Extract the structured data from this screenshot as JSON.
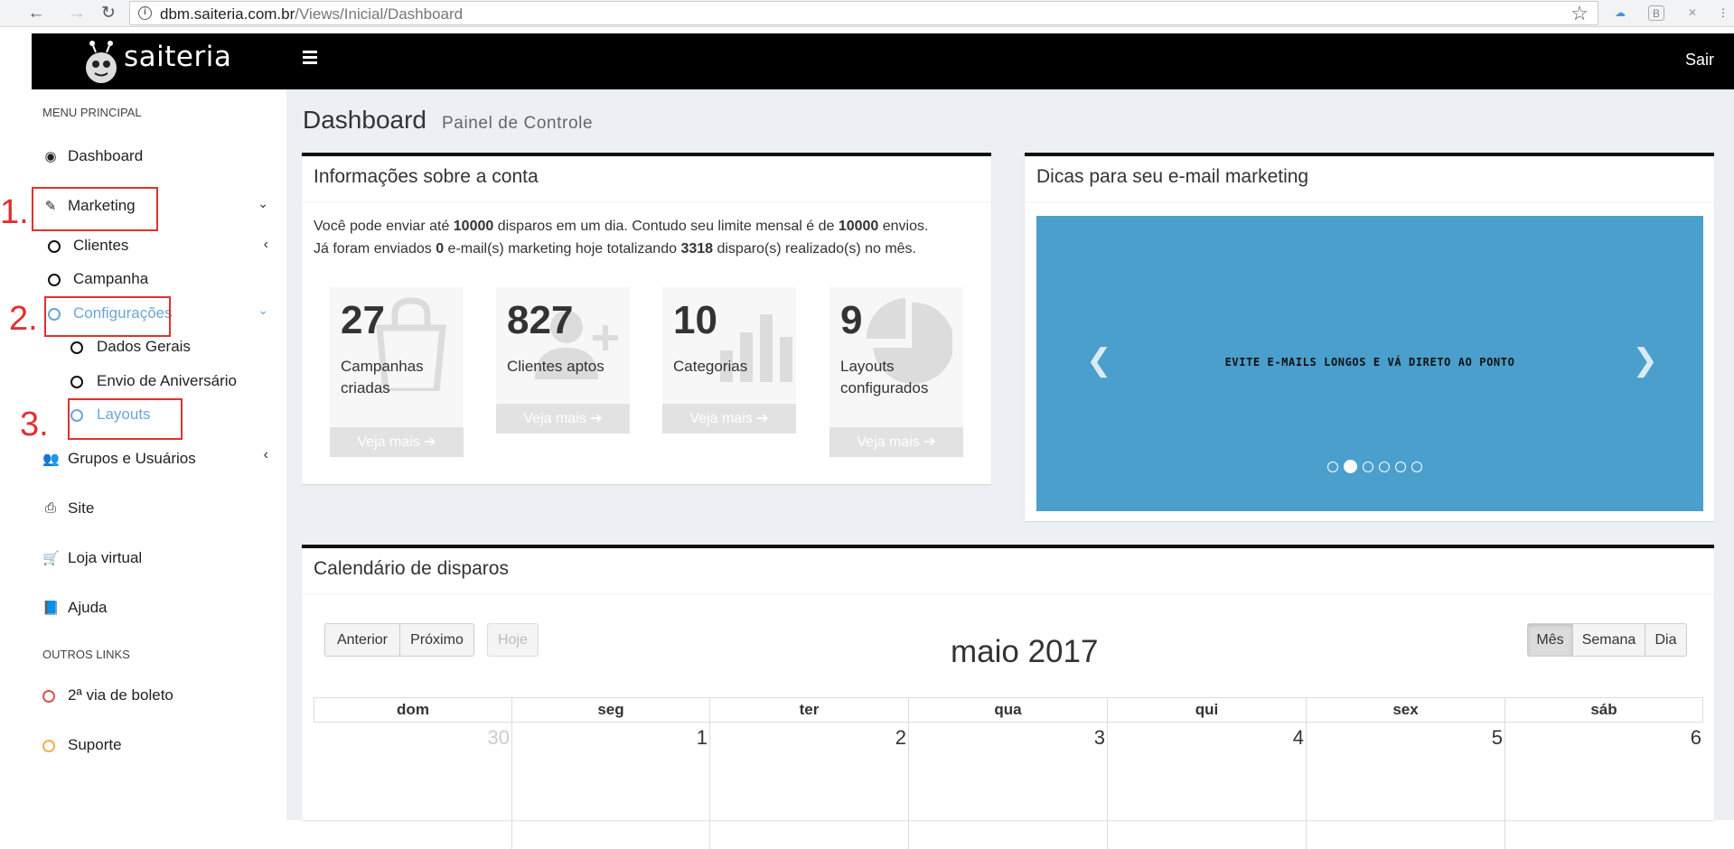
{
  "browser": {
    "url_host": "dbm.saiteria.com.br",
    "url_path": "/Views/Inicial/Dashboard"
  },
  "header": {
    "logo_text": "saiteria",
    "logout_label": "Sair"
  },
  "sidebar": {
    "main_menu_title": "MENU PRINCIPAL",
    "dashboard": "Dashboard",
    "marketing": "Marketing",
    "clientes": "Clientes",
    "campanha": "Campanha",
    "configuracoes": "Configurações",
    "dados_gerais": "Dados Gerais",
    "envio_aniversario": "Envio de Aniversário",
    "layouts": "Layouts",
    "grupos_usuarios": "Grupos e Usuários",
    "site": "Site",
    "loja_virtual": "Loja virtual",
    "ajuda": "Ajuda",
    "other_links_title": "OUTROS LINKS",
    "boleto": "2ª via de boleto",
    "suporte": "Suporte"
  },
  "annotations": [
    "1.",
    "2.",
    "3."
  ],
  "page": {
    "title": "Dashboard",
    "subtitle": "Painel de Controle"
  },
  "account": {
    "title": "Informações sobre a conta",
    "line1_a": "Você pode enviar até ",
    "line1_b": "10000",
    "line1_c": " disparos em um dia. Contudo seu limite mensal é de ",
    "line1_d": "10000",
    "line1_e": " envios.",
    "line2_a": "Já foram enviados ",
    "line2_b": "0",
    "line2_c": " e-mail(s) marketing hoje totalizando ",
    "line2_d": "3318",
    "line2_e": " disparo(s) realizado(s) no mês.",
    "stats": [
      {
        "value": "27",
        "label": "Campanhas criadas",
        "more": "Veja mais ➔",
        "icon": "shopping-bag-icon"
      },
      {
        "value": "827",
        "label": "Clientes aptos",
        "more": "Veja mais ➔",
        "icon": "user-plus-icon"
      },
      {
        "value": "10",
        "label": "Categorias",
        "more": "Veja mais ➔",
        "icon": "bar-chart-icon"
      },
      {
        "value": "9",
        "label": "Layouts configurados",
        "more": "Veja mais ➔",
        "icon": "pie-chart-icon"
      }
    ]
  },
  "tips": {
    "title": "Dicas para seu e-mail marketing",
    "slide_text": "EVITE E-MAILS LONGOS E VÁ DIRETO AO PONTO",
    "slide_count": 6,
    "active_slide": 2
  },
  "calendar": {
    "title": "Calendário de disparos",
    "prev": "Anterior",
    "next": "Próximo",
    "today": "Hoje",
    "month_title": "maio 2017",
    "view_month": "Mês",
    "view_week": "Semana",
    "view_day": "Dia",
    "weekdays": [
      "dom",
      "seg",
      "ter",
      "qua",
      "qui",
      "sex",
      "sáb"
    ],
    "days": [
      "30",
      "1",
      "2",
      "3",
      "4",
      "5",
      "6"
    ]
  },
  "colors": {
    "accent_blue": "#6aa7d6",
    "carousel_blue": "#4a9fcc",
    "annotation_red": "#e0312e"
  }
}
